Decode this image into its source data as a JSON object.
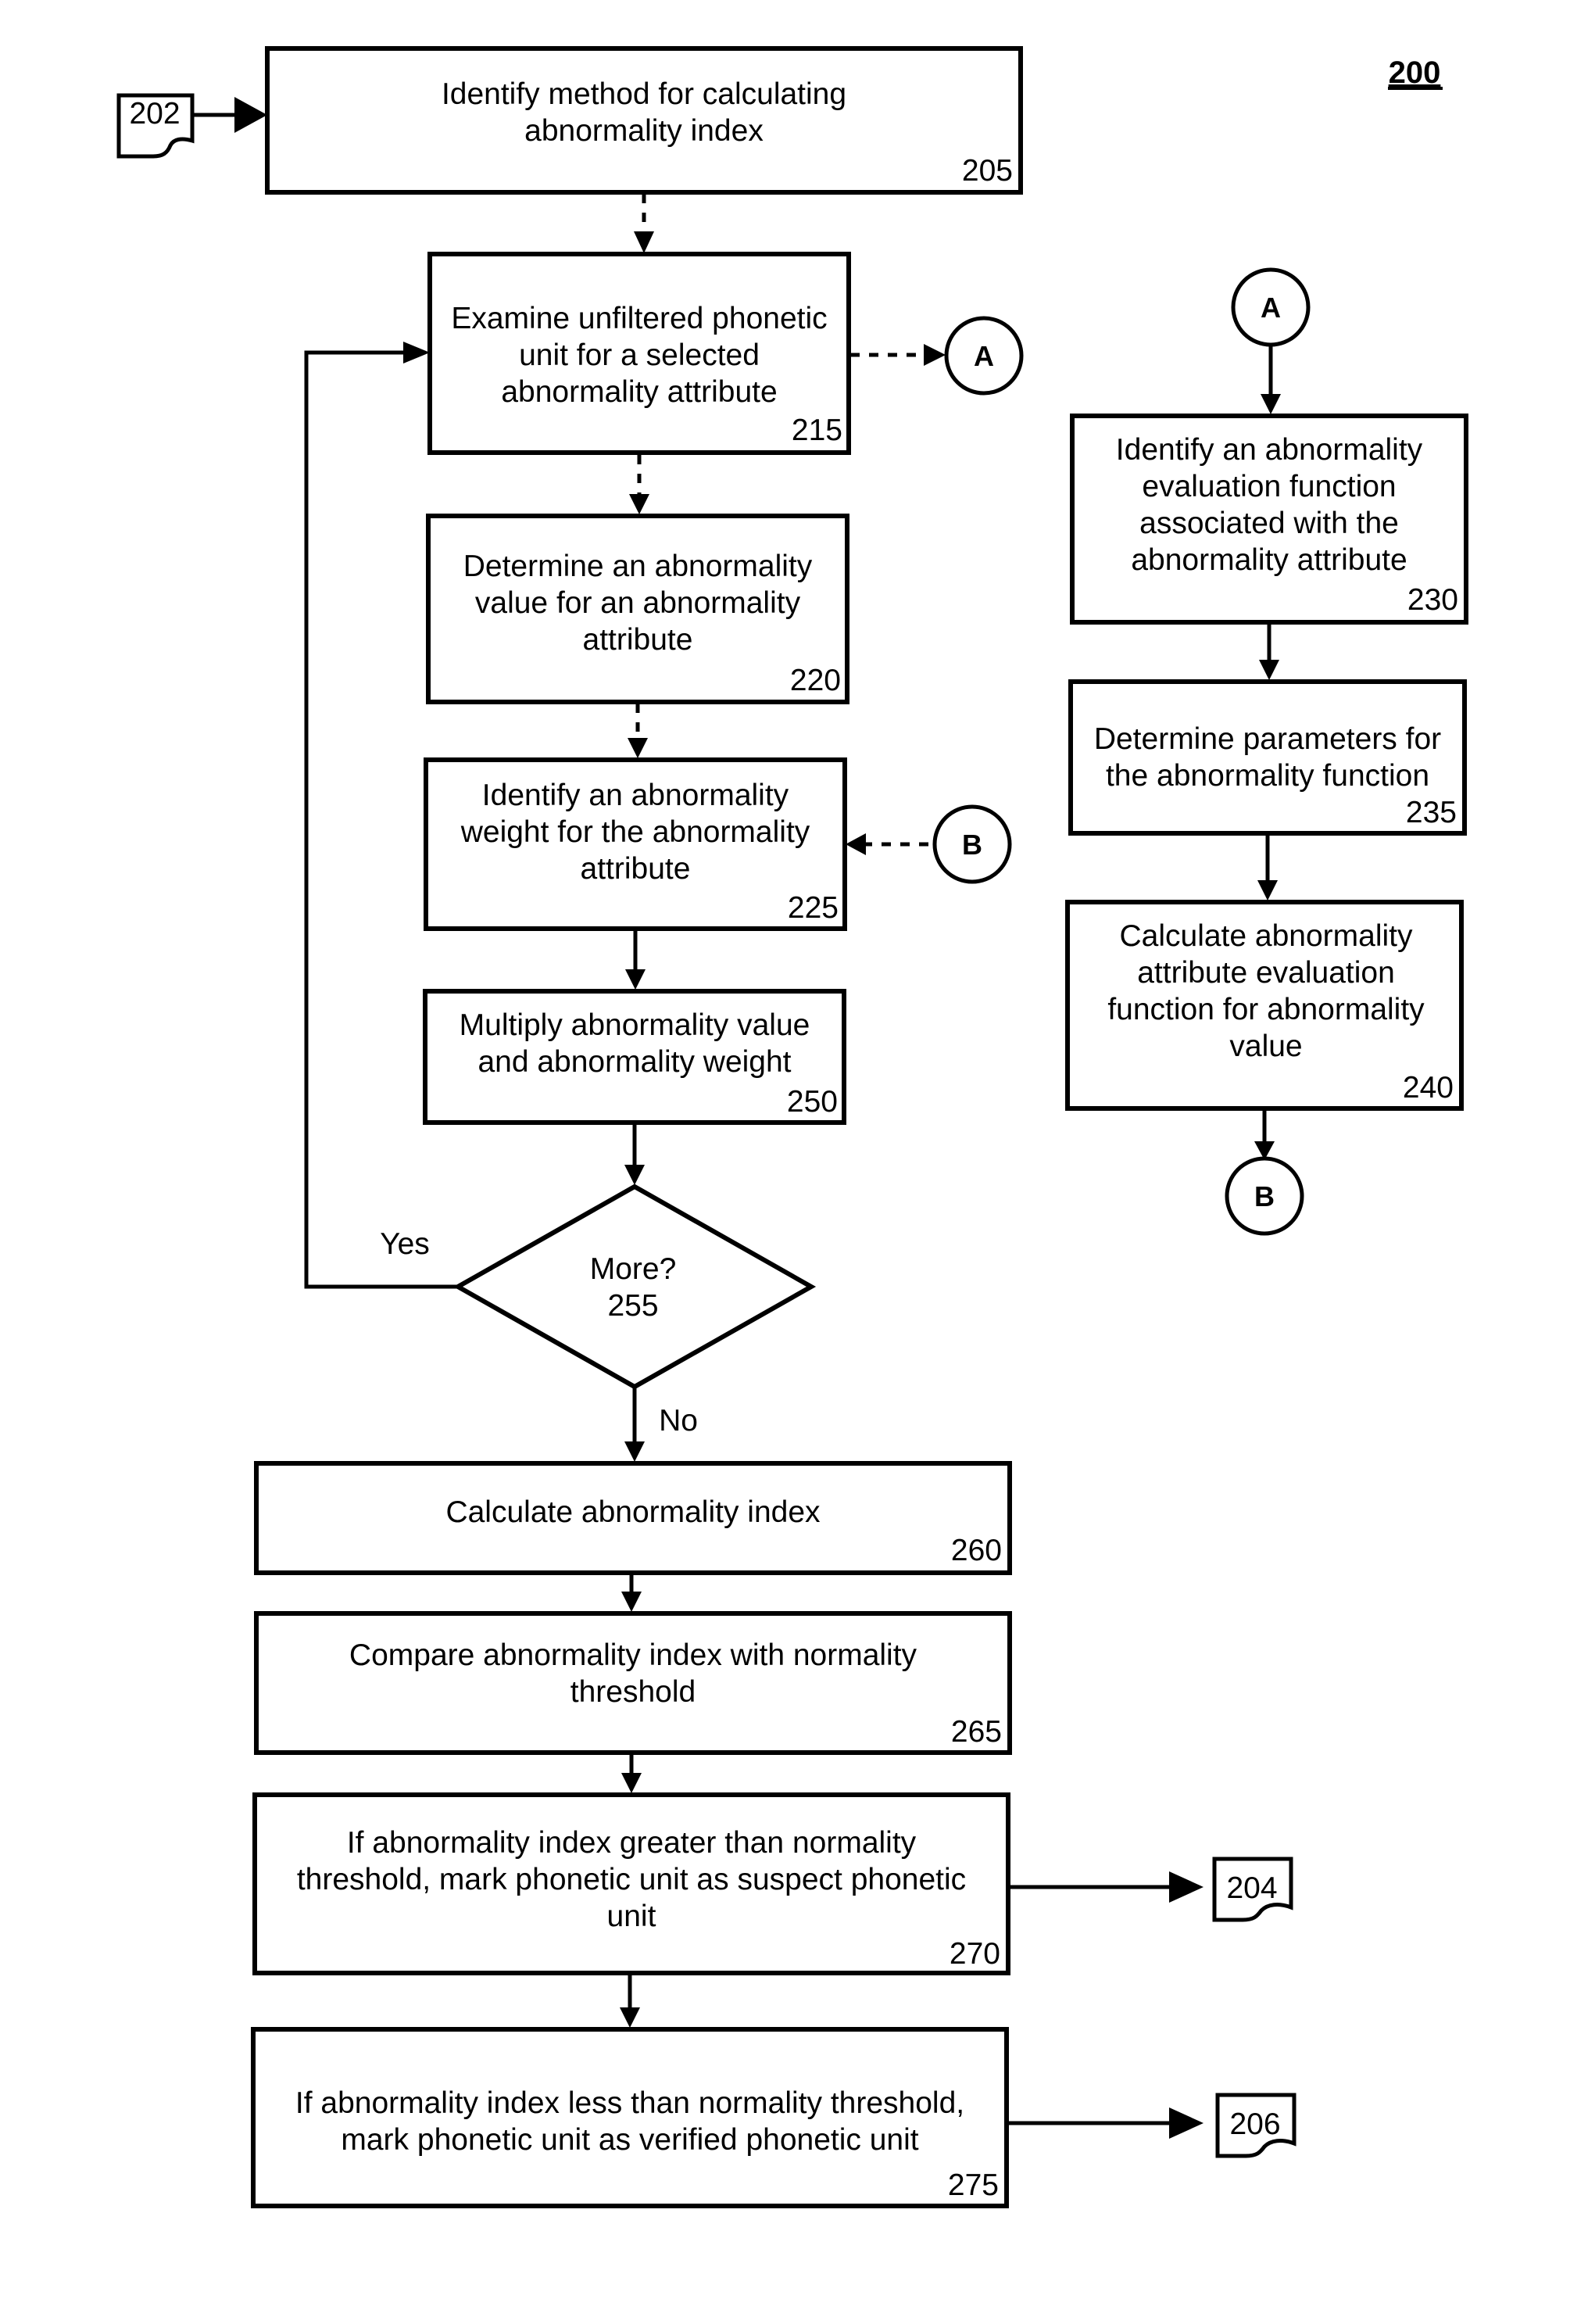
{
  "figure_number": "200",
  "steps": {
    "s205": {
      "lines": [
        "Identify method for calculating",
        "abnormality index"
      ],
      "ref": "205"
    },
    "s215": {
      "lines": [
        "Examine unfiltered phonetic",
        "unit for a selected",
        "abnormality attribute"
      ],
      "ref": "215"
    },
    "s220": {
      "lines": [
        "Determine an abnormality",
        "value for an abnormality",
        "attribute"
      ],
      "ref": "220"
    },
    "s225": {
      "lines": [
        "Identify an abnormality",
        "weight for the abnormality",
        "attribute"
      ],
      "ref": "225"
    },
    "s250": {
      "lines": [
        "Multiply abnormality value",
        "and abnormality weight"
      ],
      "ref": "250"
    },
    "s255": {
      "lines": [
        "More?",
        "255"
      ]
    },
    "s260": {
      "lines": [
        "Calculate abnormality index"
      ],
      "ref": "260"
    },
    "s265": {
      "lines": [
        "Compare abnormality index with normality",
        "threshold"
      ],
      "ref": "265"
    },
    "s270": {
      "lines": [
        "If abnormality index greater than normality",
        "threshold, mark phonetic unit as suspect phonetic",
        "unit"
      ],
      "ref": "270"
    },
    "s275": {
      "lines": [
        "If abnormality index less than normality threshold,",
        "mark phonetic unit as verified phonetic unit"
      ],
      "ref": "275"
    },
    "s230": {
      "lines": [
        "Identify an abnormality",
        "evaluation function",
        "associated with the",
        "abnormality attribute"
      ],
      "ref": "230"
    },
    "s235": {
      "lines": [
        "Determine parameters for",
        "the abnormality function"
      ],
      "ref": "235"
    },
    "s240": {
      "lines": [
        "Calculate abnormality",
        "attribute evaluation",
        "function for abnormality",
        "value"
      ],
      "ref": "240"
    }
  },
  "connectors": {
    "a_out": "A",
    "a_in": "A",
    "b_out": "B",
    "b_in": "B"
  },
  "offpage": {
    "in_202": "202",
    "out_204": "204",
    "out_206": "206"
  },
  "decision_labels": {
    "yes": "Yes",
    "no": "No"
  }
}
